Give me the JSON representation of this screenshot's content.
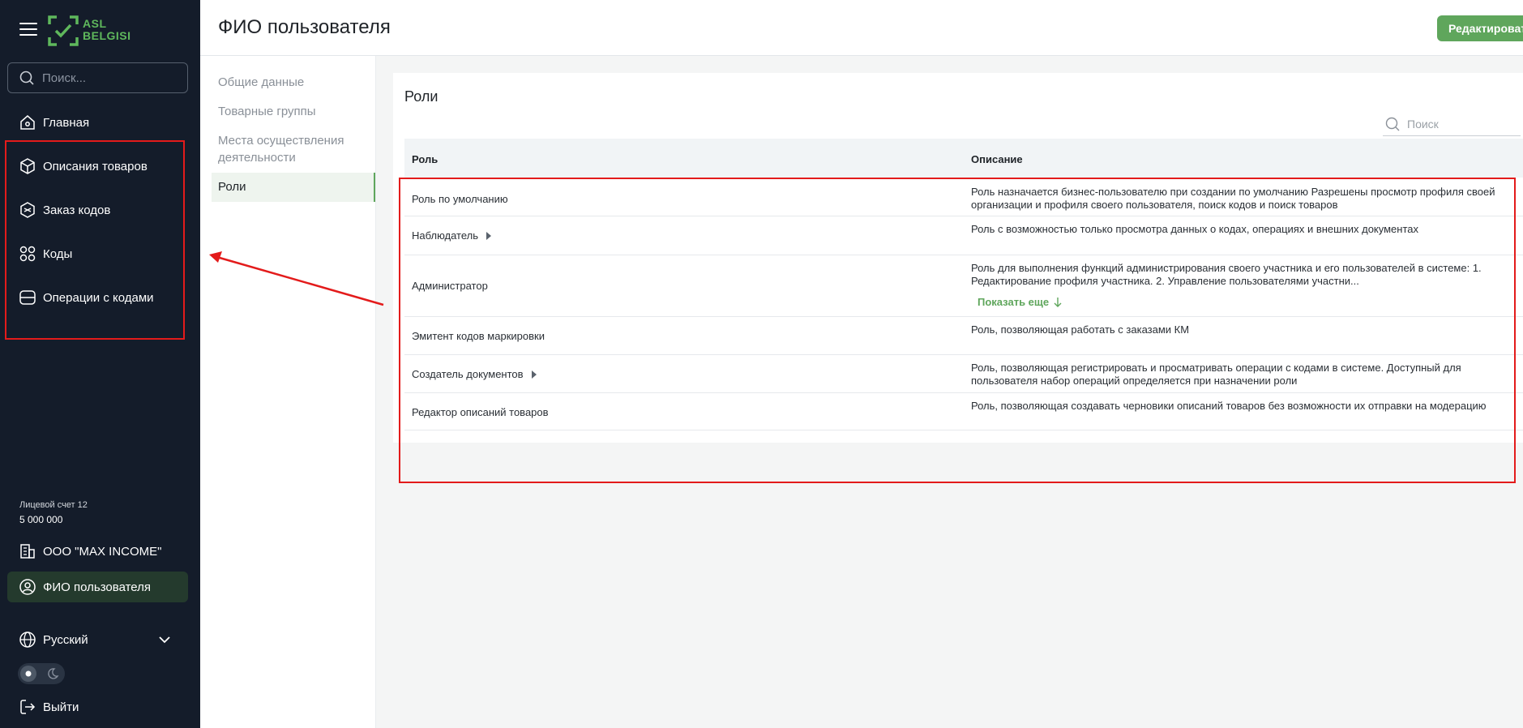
{
  "sidebar": {
    "logo_text": [
      "ASL",
      "BELGISI"
    ],
    "search_placeholder": "Поиск...",
    "nav": [
      {
        "label": "Главная",
        "icon": "home-icon"
      },
      {
        "label": "Описания товаров",
        "icon": "cube-icon"
      },
      {
        "label": "Заказ кодов",
        "icon": "box-icon"
      },
      {
        "label": "Коды",
        "icon": "codes-icon"
      },
      {
        "label": "Операции с кодами",
        "icon": "operations-icon"
      }
    ],
    "account_label": "Лицевой счет 12",
    "account_value": "5 000 000",
    "org": "ООО \"MAX INCOME\"",
    "user": "ФИО пользователя",
    "language": "Русский",
    "logout": "Выйти"
  },
  "header": {
    "title": "ФИО пользователя",
    "edit_label": "Редактировать"
  },
  "tabs": [
    "Общие данные",
    "Товарные группы",
    "Места осуществления деятельности",
    "Роли"
  ],
  "roles": {
    "title": "Роли",
    "search_placeholder": "Поиск",
    "columns": {
      "role": "Роль",
      "description": "Описание"
    },
    "rows": [
      {
        "role": "Роль по умолчанию",
        "description": "Роль назначается бизнес-пользователю при создании по умолчанию Разрешены просмотр профиля своей организации и профиля своего пользователя, поиск кодов и поиск товаров"
      },
      {
        "role": "Наблюдатель",
        "description": "Роль с возможностью только просмотра данных о кодах, операциях и внешних документах"
      },
      {
        "role": "Администратор",
        "description": "Роль для выполнения функций администрирования своего участника и его пользователей в системе: 1. Редактирование профиля участника. 2. Управление пользователями участни..."
      },
      {
        "role": "Эмитент кодов маркировки",
        "description": "Роль, позволяющая работать с заказами КМ"
      },
      {
        "role": "Создатель документов",
        "description": "Роль, позволяющая регистрировать и просматривать операции с кодами в системе. Доступный для пользователя набор операций определяется при назначении роли"
      },
      {
        "role": "Редактор описаний товаров",
        "description": "Роль, позволяющая создавать черновики описаний товаров без возможности их отправки на модерацию"
      }
    ],
    "show_more": "Показать еще"
  },
  "colors": {
    "sidebar_bg": "#141c2a",
    "accent": "#5fa65c",
    "annotation": "#e31b1b"
  }
}
